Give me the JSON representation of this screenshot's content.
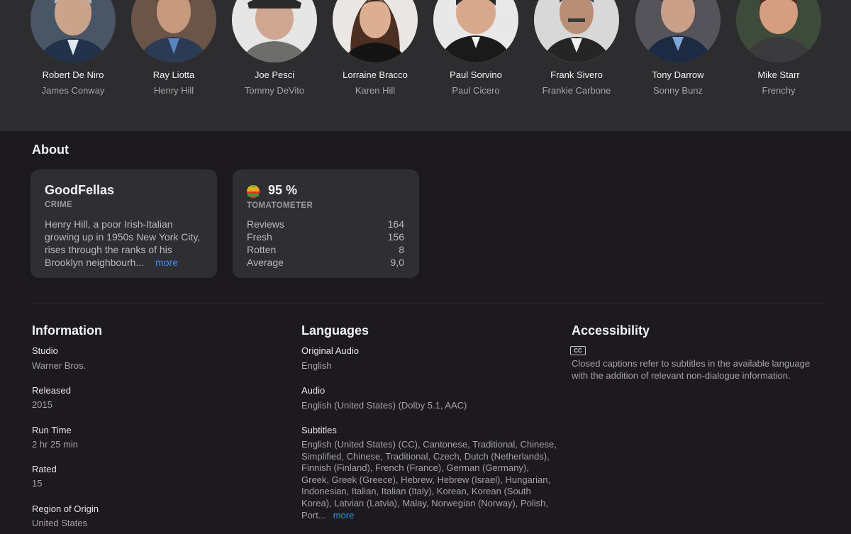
{
  "cast": [
    {
      "name": "Robert De Niro",
      "role": "James Conway"
    },
    {
      "name": "Ray Liotta",
      "role": "Henry Hill"
    },
    {
      "name": "Joe Pesci",
      "role": "Tommy DeVito"
    },
    {
      "name": "Lorraine Bracco",
      "role": "Karen Hill"
    },
    {
      "name": "Paul Sorvino",
      "role": "Paul Cicero"
    },
    {
      "name": "Frank Sivero",
      "role": "Frankie Carbone"
    },
    {
      "name": "Tony Darrow",
      "role": "Sonny Bunz"
    },
    {
      "name": "Mike Starr",
      "role": "Frenchy"
    }
  ],
  "about": {
    "title": "About",
    "movie_card": {
      "title": "GoodFellas",
      "genre": "CRIME",
      "description": "Henry Hill, a poor Irish-Italian growing up in 1950s New York City, rises through the ranks of his Brooklyn neighbourh...",
      "more_label": "more"
    },
    "rating_card": {
      "icon": "tomato-icon",
      "score": "95 %",
      "label": "TOMATOMETER",
      "rows": [
        {
          "label": "Reviews",
          "value": "164"
        },
        {
          "label": "Fresh",
          "value": "156"
        },
        {
          "label": "Rotten",
          "value": "8"
        },
        {
          "label": "Average",
          "value": "9,0"
        }
      ]
    }
  },
  "information": {
    "title": "Information",
    "fields": [
      {
        "label": "Studio",
        "value": "Warner Bros."
      },
      {
        "label": "Released",
        "value": "2015"
      },
      {
        "label": "Run Time",
        "value": "2 hr 25 min"
      },
      {
        "label": "Rated",
        "value": "15"
      },
      {
        "label": "Region of Origin",
        "value": "United States"
      }
    ]
  },
  "languages": {
    "title": "Languages",
    "original_audio_label": "Original Audio",
    "original_audio": "English",
    "audio_label": "Audio",
    "audio": "English (United States) (Dolby 5.1, AAC)",
    "subtitles_label": "Subtitles",
    "subtitles": "English (United States) (CC), Cantonese, Traditional, Chinese, Simplified, Chinese, Traditional, Czech, Dutch (Netherlands), Finnish (Finland), French (France), German (Germany), Greek, Greek (Greece), Hebrew, Hebrew (Israel), Hungarian, Indonesian, Italian, Italian (Italy), Korean, Korean (South Korea), Latvian (Latvia), Malay, Norwegian (Norway), Polish, Port...",
    "more_label": "more"
  },
  "accessibility": {
    "title": "Accessibility",
    "badge": "CC",
    "text": "Closed captions refer to subtitles in the available language with the addition of relevant non-dialogue information."
  }
}
